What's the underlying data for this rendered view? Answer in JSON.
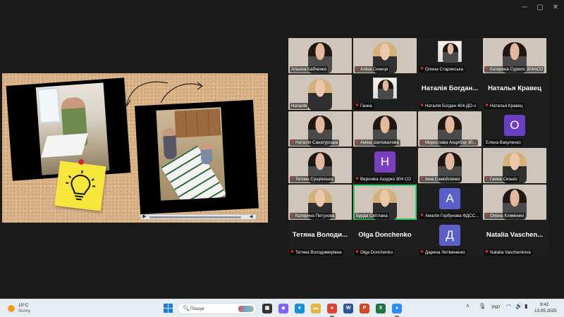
{
  "window_controls": {
    "minimize": "─",
    "maximize": "▢",
    "close": "✕"
  },
  "slide": {
    "video_play_glyph": "▶",
    "video_volume_glyph": "◀"
  },
  "participants": [
    {
      "name": "Альона Бабченко",
      "muted": false,
      "type": "video",
      "style": "bg-warm",
      "face": "dark"
    },
    {
      "name": "Аліна Синиця",
      "muted": true,
      "type": "video",
      "style": "bg-light",
      "face": "blonde"
    },
    {
      "name": "Олена Старинська",
      "muted": true,
      "type": "pip",
      "style": "name-tile",
      "face": "dark"
    },
    {
      "name": "Катерина Сурело 304АСО",
      "muted": true,
      "type": "video",
      "style": "bg-light",
      "face": "dark"
    },
    {
      "name": "Наталія",
      "muted": false,
      "type": "video",
      "style": "bg-blue",
      "face": "blonde"
    },
    {
      "name": "Ганна",
      "muted": true,
      "type": "pip",
      "style": "name-tile",
      "face": "dark"
    },
    {
      "name": "Наталія Богдан 404-ДО-з",
      "muted": true,
      "type": "name",
      "big": "Наталія Богдан...",
      "style": "name-tile"
    },
    {
      "name": "Наталья Кравец",
      "muted": true,
      "type": "name",
      "big": "Наталья Кравец",
      "style": "name-tile"
    },
    {
      "name": "Наталія Санагурська",
      "muted": true,
      "type": "video",
      "style": "bg-warm",
      "face": "dark"
    },
    {
      "name": "Аміна Шаповалова",
      "muted": true,
      "type": "video",
      "style": "bg-office",
      "face": "dark"
    },
    {
      "name": "Мирослава Анцибор 30...",
      "muted": true,
      "type": "video",
      "style": "bg-light",
      "face": "dark"
    },
    {
      "name": "Елена Вакуленко",
      "muted": false,
      "type": "avatar",
      "letter": "О",
      "color": "#6b3fc4",
      "style": "name-tile"
    },
    {
      "name": "Тетяна Сущинська",
      "muted": true,
      "type": "video",
      "style": "bg-light",
      "face": "dark"
    },
    {
      "name": "Вероніка Ашурко 304 СО",
      "muted": true,
      "type": "avatar",
      "letter": "Н",
      "color": "#7a3fbf",
      "style": "name-tile"
    },
    {
      "name": "Інна Самойленко",
      "muted": true,
      "type": "video",
      "style": "bg-light",
      "face": "dark"
    },
    {
      "name": "Ганна Сизько",
      "muted": true,
      "type": "video",
      "style": "bg-office",
      "face": "blonde"
    },
    {
      "name": "Катерина Петухова",
      "muted": true,
      "type": "video",
      "style": "bg-office",
      "face": "blonde"
    },
    {
      "name": "Бурда Світлана",
      "muted": false,
      "type": "video",
      "style": "bg-green",
      "face": "blonde",
      "active": true
    },
    {
      "name": "Амалія Горбунова ФДСС...",
      "muted": true,
      "type": "avatar",
      "letter": "А",
      "color": "#5b5fc7",
      "style": "name-tile"
    },
    {
      "name": "Олена Клименко",
      "muted": true,
      "type": "video",
      "style": "bg-light",
      "face": "dark"
    },
    {
      "name": "Тетяна Володимирівна",
      "muted": true,
      "type": "name",
      "big": "Тетяна Володи...",
      "style": "name-tile"
    },
    {
      "name": "Olga Donchenko",
      "muted": true,
      "type": "name",
      "big": "Olga Donchenko",
      "style": "name-tile"
    },
    {
      "name": "Дарина Литвиненко",
      "muted": true,
      "type": "avatar",
      "letter": "Д",
      "color": "#5b5fc7",
      "style": "name-tile"
    },
    {
      "name": "Natalia Vaschenkova",
      "muted": true,
      "type": "name",
      "big": "Natalia Vaschen...",
      "style": "name-tile"
    }
  ],
  "taskbar": {
    "weather_temp": "10°C",
    "weather_desc": "Sunny",
    "search_placeholder": "Пошук",
    "search_glyph": "🔍",
    "apps": [
      {
        "name": "task-view",
        "glyph": "▣",
        "color": "#333"
      },
      {
        "name": "copilot",
        "glyph": "◆",
        "color": "#7b61ff"
      },
      {
        "name": "edge",
        "glyph": "e",
        "color": "#1b8fd6"
      },
      {
        "name": "file-explorer",
        "glyph": "▬",
        "color": "#e8b43a"
      },
      {
        "name": "chrome",
        "glyph": "●",
        "color": "#db4437",
        "open": true
      },
      {
        "name": "word",
        "glyph": "W",
        "color": "#2b579a"
      },
      {
        "name": "powerpoint",
        "glyph": "P",
        "color": "#d24726"
      },
      {
        "name": "excel",
        "glyph": "X",
        "color": "#217346"
      },
      {
        "name": "zoom",
        "glyph": "●",
        "color": "#2d8cff",
        "open": true
      }
    ],
    "tray_chevron": "˄",
    "tray_mic": "🎙",
    "language": "УКР",
    "tray_wifi": "◠",
    "tray_volume": "🔊",
    "tray_battery": "▮",
    "time": "9:42",
    "date": "13.05.2025"
  }
}
